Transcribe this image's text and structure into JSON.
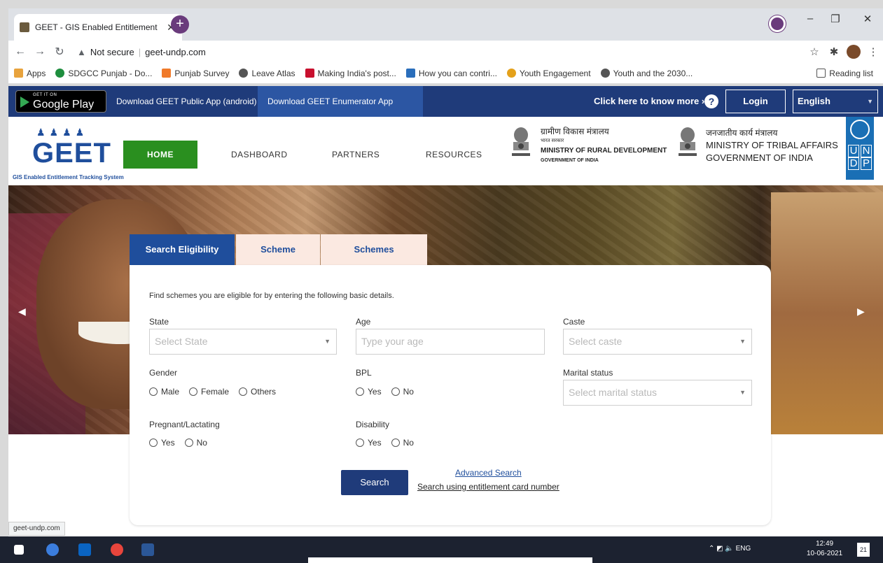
{
  "browser": {
    "tab_title": "GEET - GIS Enabled Entitlement T",
    "address_security": "Not secure",
    "address_url": "geet-undp.com",
    "bookmarks": [
      "Apps",
      "SDGCC Punjab - Do...",
      "Punjab Survey",
      "Leave Atlas",
      "Making India's post...",
      "How you can contri...",
      "Youth Engagement",
      "Youth and the 2030..."
    ],
    "reading_list": "Reading list",
    "status_url": "geet-undp.com"
  },
  "topbar": {
    "gplay_small": "GET IT ON",
    "gplay_big": "Google Play",
    "download_public": "Download GEET Public App (android)",
    "download_enumerator": "Download GEET Enumerator App (android)",
    "know_more": "Click here to know more ›",
    "help": "?",
    "login": "Login",
    "language": "English"
  },
  "header": {
    "logo_text": "GEET",
    "logo_sub": "GIS Enabled Entitlement Tracking System",
    "nav": {
      "home": "HOME",
      "dashboard": "DASHBOARD",
      "partners": "PARTNERS",
      "resources": "RESOURCES"
    },
    "mord_hi": "ग्रामीण विकास मंत्रालय",
    "mord_hi_sub": "भारत सरकार",
    "mord_en": "MINISTRY OF RURAL DEVELOPMENT",
    "mord_gov": "GOVERNMENT OF INDIA",
    "mota_hi": "जनजातीय कार्य मंत्रालय",
    "mota_en": "MINISTRY OF TRIBAL AFFAIRS",
    "mota_gov": "GOVERNMENT OF INDIA",
    "undp": [
      "U",
      "N",
      "D",
      "P"
    ]
  },
  "search": {
    "tabs": [
      "Search Eligibility",
      "Scheme Search",
      "Schemes Information"
    ],
    "intro": "Find schemes you are eligible for by entering the following basic details.",
    "state_label": "State",
    "state_placeholder": "Select State",
    "age_label": "Age",
    "age_placeholder": "Type your age",
    "caste_label": "Caste",
    "caste_placeholder": "Select caste",
    "gender_label": "Gender",
    "gender_options": [
      "Male",
      "Female",
      "Others"
    ],
    "bpl_label": "BPL",
    "bpl_options": [
      "Yes",
      "No"
    ],
    "marital_label": "Marital status",
    "marital_placeholder": "Select marital status",
    "pregnant_label": "Pregnant/Lactating",
    "pregnant_options": [
      "Yes",
      "No"
    ],
    "disability_label": "Disability",
    "disability_options": [
      "Yes",
      "No"
    ],
    "search_button": "Search",
    "advanced_search": "Advanced Search",
    "card_search": "Search using entitlement card number"
  },
  "taskbar": {
    "lang": "ENG",
    "time": "12:49",
    "date": "10-06-2021",
    "notif_count": "21"
  }
}
